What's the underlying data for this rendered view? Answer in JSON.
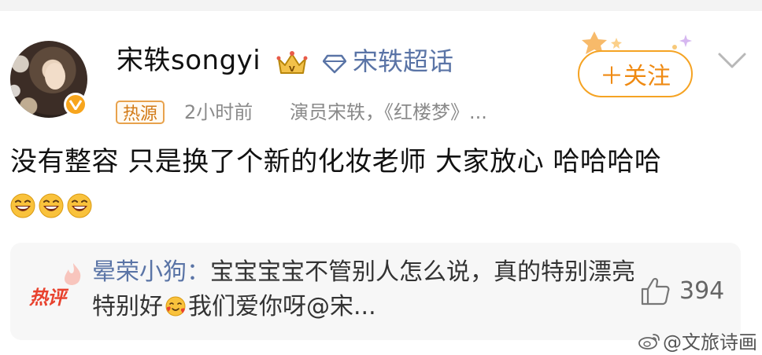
{
  "post": {
    "username": "宋轶songyi",
    "topic": "宋轶超话",
    "follow_label": "＋关注",
    "hot_tag": "热源",
    "time": "2小时前",
    "description": "演员宋轶，《红楼梦》...",
    "text": "没有整容 只是换了个新的化妆老师 大家放心 哈哈哈哈",
    "emojis": [
      "grinning-face",
      "grinning-face",
      "grinning-face"
    ]
  },
  "hot_comment": {
    "badge": "热评",
    "author": "晕荣小狗",
    "separator": "：",
    "text_before": "宝宝宝宝不管别人怎么说，真的特别漂亮特别好",
    "emoji": "smiling-face-with-hearts",
    "text_after": "我们爱你呀@宋...",
    "like_count": "394"
  },
  "watermark": {
    "text": "@文旅诗画"
  },
  "colors": {
    "link_blue": "#5a74a6",
    "follow_orange": "#ef8a12",
    "hot_tag_orange": "#d27a16",
    "hot_comment_red": "#e8422e",
    "meta_gray": "#8a8a8a"
  }
}
